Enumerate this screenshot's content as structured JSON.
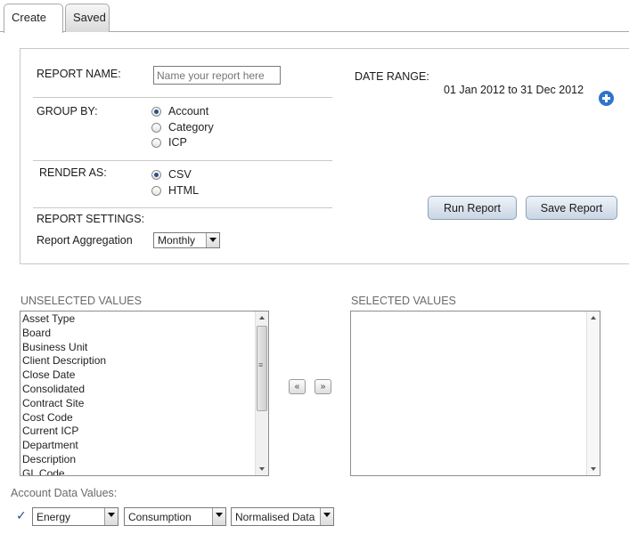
{
  "tabs": [
    {
      "label": "Create"
    },
    {
      "label": "Saved"
    }
  ],
  "form": {
    "report_name_label": "REPORT NAME:",
    "report_name_placeholder": "Name your report here",
    "group_by_label": "GROUP BY:",
    "group_by_options": [
      "Account",
      "Category",
      "ICP"
    ],
    "group_by_selected": "Account",
    "render_as_label": "RENDER AS:",
    "render_as_options": [
      "CSV",
      "HTML"
    ],
    "render_as_selected": "CSV",
    "report_settings_label": "REPORT SETTINGS:",
    "aggregation_label": "Report Aggregation",
    "aggregation_value": "Monthly",
    "date_range_label": "DATE RANGE:",
    "date_range_value": "01 Jan 2012  to 31 Dec 2012",
    "run_button": "Run Report",
    "save_button": "Save Report"
  },
  "values": {
    "unselected_label": "UNSELECTED VALUES",
    "selected_label": "SELECTED VALUES",
    "unselected_items": [
      "Asset Type",
      "Board",
      "Business Unit",
      "Client Description",
      "Close Date",
      "Consolidated",
      "Contract Site",
      "Cost Code",
      "Current ICP",
      "Department",
      "Description",
      "GL Code"
    ],
    "selected_items": [],
    "move_left": "«",
    "move_right": "»"
  },
  "account_data": {
    "label": "Account Data Values:",
    "dropdowns": [
      "Energy",
      "Consumption",
      "Normalised Data"
    ]
  },
  "colors": {
    "accent": "#2f74c8",
    "checkmark": "#2b4f8a",
    "label_gray": "#6a6a6a"
  },
  "icons": {
    "add": "plus-circle-icon",
    "check": "checkmark-icon"
  }
}
